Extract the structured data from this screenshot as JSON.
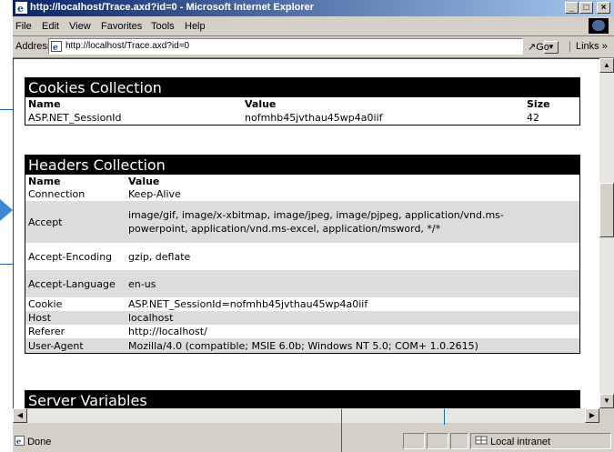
{
  "window": {
    "title": "http://localhost/Trace.axd?id=0 - Microsoft Internet Explorer",
    "controls": {
      "minimize": "_",
      "maximize": "×̅",
      "close": "×"
    }
  },
  "menubar": [
    "File",
    "Edit",
    "View",
    "Favorites",
    "Tools",
    "Help"
  ],
  "addressbar": {
    "label": "Address",
    "url": "http://localhost/Trace.axd?id=0",
    "go": "↗Go",
    "links": "Links »"
  },
  "cookies": {
    "title": "Cookies Collection",
    "headers": [
      "Name",
      "Value",
      "Size"
    ],
    "rows": [
      [
        "ASP.NET_SessionId",
        "nofmhb45jvthau45wp4a0iif",
        "42"
      ]
    ]
  },
  "headers_collection": {
    "title": "Headers Collection",
    "headers": [
      "Name",
      "Value"
    ],
    "rows": [
      [
        "Connection",
        "Keep-Alive"
      ],
      [
        "Accept",
        "image/gif, image/x-xbitmap, image/jpeg, image/pjpeg, application/vnd.ms-powerpoint, application/vnd.ms-excel, application/msword, */*"
      ],
      [
        "Accept-Encoding",
        "gzip, deflate"
      ],
      [
        "Accept-Language",
        "en-us"
      ],
      [
        "Cookie",
        "ASP.NET_SessionId=nofmhb45jvthau45wp4a0iif"
      ],
      [
        "Host",
        "localhost"
      ],
      [
        "Referer",
        "http://localhost/"
      ],
      [
        "User-Agent",
        "Mozilla/4.0 (compatible; MSIE 6.0b; Windows NT 5.0; COM+ 1.0.2615)"
      ]
    ]
  },
  "server_variables": {
    "title": "Server Variables"
  },
  "statusbar": {
    "status": "Done",
    "zone": "Local intranet"
  }
}
